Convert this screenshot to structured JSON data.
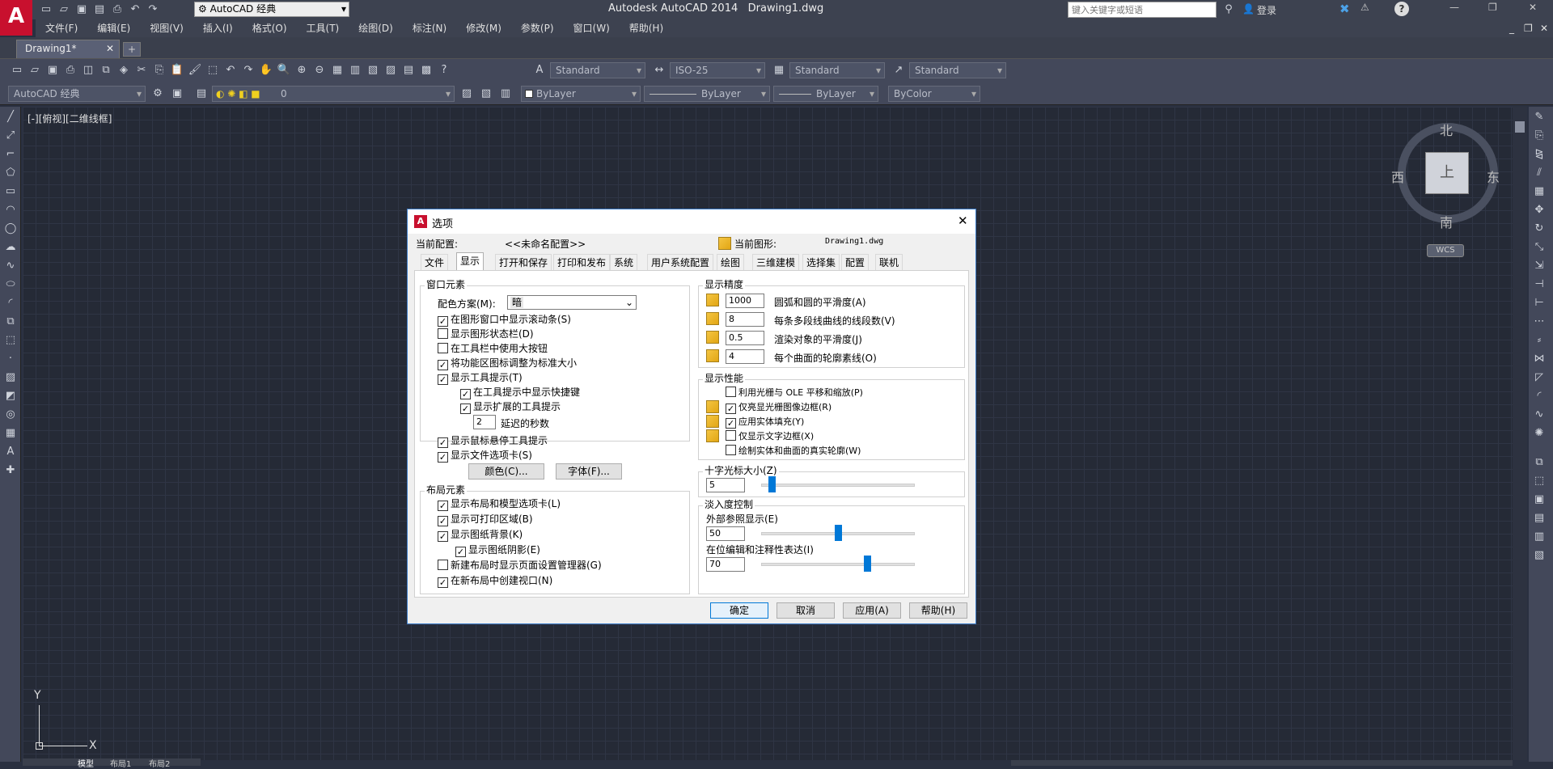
{
  "titlebar": {
    "app_title": "Autodesk AutoCAD 2014",
    "doc_title": "Drawing1.dwg",
    "workspace": "AutoCAD 经典",
    "search_placeholder": "键入关键字或短语",
    "login": "登录"
  },
  "menubar": [
    "文件(F)",
    "编辑(E)",
    "视图(V)",
    "插入(I)",
    "格式(O)",
    "工具(T)",
    "绘图(D)",
    "标注(N)",
    "修改(M)",
    "参数(P)",
    "窗口(W)",
    "帮助(H)"
  ],
  "doc_tab": "Drawing1*",
  "toolbar": {
    "text_style": "Standard",
    "dim_style": "ISO-25",
    "table_style": "Standard",
    "mleader_style": "Standard",
    "workspace_combo": "AutoCAD 经典",
    "layer": "0",
    "color": "ByLayer",
    "linetype": "ByLayer",
    "lineweight": "ByLayer",
    "plotstyle": "ByColor"
  },
  "viewport_label": "[-][俯视][二维线框]",
  "viewcube": {
    "north": "北",
    "south": "南",
    "east": "东",
    "west": "西",
    "top": "上",
    "wcs": "WCS"
  },
  "ucs": {
    "x": "X",
    "y": "Y"
  },
  "layout_tabs": [
    "模型",
    "布局1",
    "布局2"
  ],
  "dialog": {
    "title": "选项",
    "current_profile_label": "当前配置:",
    "current_profile": "<<未命名配置>>",
    "current_drawing_label": "当前图形:",
    "current_drawing": "Drawing1.dwg",
    "tabs": [
      "文件",
      "显示",
      "打开和保存",
      "打印和发布",
      "系统",
      "用户系统配置",
      "绘图",
      "三维建模",
      "选择集",
      "配置",
      "联机"
    ],
    "window_elements": {
      "title": "窗口元素",
      "color_scheme_label": "配色方案(M):",
      "color_scheme": "暗",
      "items": [
        {
          "label": "在图形窗口中显示滚动条(S)",
          "checked": true
        },
        {
          "label": "显示图形状态栏(D)",
          "checked": false
        },
        {
          "label": "在工具栏中使用大按钮",
          "checked": false
        },
        {
          "label": "将功能区图标调整为标准大小",
          "checked": true
        },
        {
          "label": "显示工具提示(T)",
          "checked": true
        },
        {
          "label": "在工具提示中显示快捷键",
          "checked": true
        },
        {
          "label": "显示扩展的工具提示",
          "checked": true
        },
        {
          "label": "显示鼠标悬停工具提示",
          "checked": true
        },
        {
          "label": "显示文件选项卡(S)",
          "checked": true
        }
      ],
      "delay_value": "2",
      "delay_label": "延迟的秒数",
      "colors_button": "颜色(C)...",
      "fonts_button": "字体(F)..."
    },
    "layout_elements": {
      "title": "布局元素",
      "items": [
        {
          "label": "显示布局和模型选项卡(L)",
          "checked": true
        },
        {
          "label": "显示可打印区域(B)",
          "checked": true
        },
        {
          "label": "显示图纸背景(K)",
          "checked": true
        },
        {
          "label": "显示图纸阴影(E)",
          "checked": true
        },
        {
          "label": "新建布局时显示页面设置管理器(G)",
          "checked": false
        },
        {
          "label": "在新布局中创建视口(N)",
          "checked": true
        }
      ]
    },
    "display_resolution": {
      "title": "显示精度",
      "items": [
        {
          "value": "1000",
          "label": "圆弧和圆的平滑度(A)"
        },
        {
          "value": "8",
          "label": "每条多段线曲线的线段数(V)"
        },
        {
          "value": "0.5",
          "label": "渲染对象的平滑度(J)"
        },
        {
          "value": "4",
          "label": "每个曲面的轮廓素线(O)"
        }
      ]
    },
    "display_performance": {
      "title": "显示性能",
      "items": [
        {
          "label": "利用光栅与 OLE 平移和缩放(P)",
          "checked": false
        },
        {
          "label": "仅亮显光栅图像边框(R)",
          "checked": true
        },
        {
          "label": "应用实体填充(Y)",
          "checked": true
        },
        {
          "label": "仅显示文字边框(X)",
          "checked": false
        },
        {
          "label": "绘制实体和曲面的真实轮廓(W)",
          "checked": false
        }
      ]
    },
    "crosshair": {
      "title": "十字光标大小(Z)",
      "value": "5",
      "fraction": 0.05
    },
    "fade_control": {
      "title": "淡入度控制",
      "xref_label": "外部参照显示(E)",
      "xref_value": "50",
      "xref_fraction": 0.5,
      "inplace_label": "在位编辑和注释性表达(I)",
      "inplace_value": "70",
      "inplace_fraction": 0.7
    },
    "buttons": {
      "ok": "确定",
      "cancel": "取消",
      "apply": "应用(A)",
      "help": "帮助(H)"
    }
  }
}
